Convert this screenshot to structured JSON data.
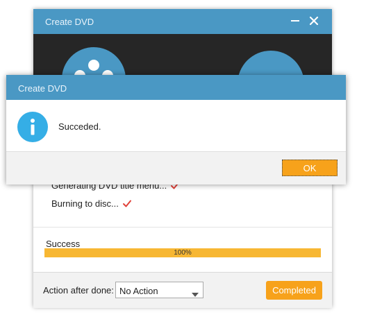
{
  "main_window": {
    "title": "Create DVD",
    "steps": [
      {
        "label": "Generating DVD title menu...",
        "done": true
      },
      {
        "label": "Burning to disc...",
        "done": true
      }
    ],
    "status": "Success",
    "progress": {
      "percent": 100,
      "label": "100%"
    },
    "footer": {
      "action_label": "Action after done:",
      "action_value": "No Action",
      "completed_label": "Completed"
    }
  },
  "dialog": {
    "title": "Create DVD",
    "message": "Succeded.",
    "ok_label": "OK"
  },
  "colors": {
    "titlebar": "#4a98c4",
    "accent_orange": "#f7a21b",
    "progress_fill": "#f7b733",
    "check_red": "#e0423a",
    "info_blue": "#35aee6"
  },
  "icons": [
    "minimize-icon",
    "close-icon",
    "film-reel-icon",
    "disc-icon",
    "check-icon",
    "info-icon",
    "chevron-down-icon"
  ]
}
